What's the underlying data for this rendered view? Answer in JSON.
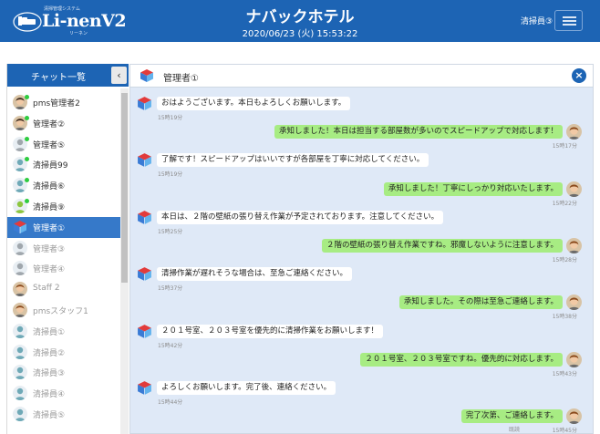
{
  "header": {
    "logo_system": "清掃管理システム",
    "logo_name": "Li-nenV2",
    "logo_ruby": "リーネン",
    "hotel_name": "ナバックホテル",
    "datetime": "2020/06/23 (火) 15:53:22",
    "user": "清掃員③"
  },
  "sidebar": {
    "title": "チャット一覧",
    "collapse_icon": "‹",
    "users": [
      {
        "name": "pms管理者2",
        "status": "online",
        "avatar": "photo-man"
      },
      {
        "name": "管理者②",
        "status": "online",
        "avatar": "photo-man"
      },
      {
        "name": "管理者⑤",
        "status": "online",
        "avatar": "person-grey"
      },
      {
        "name": "清掃員99",
        "status": "online",
        "avatar": "person-teal"
      },
      {
        "name": "清掃員⑥",
        "status": "online",
        "avatar": "person-teal"
      },
      {
        "name": "清掃員⑨",
        "status": "online",
        "avatar": "person-green"
      },
      {
        "name": "管理者①",
        "status": "active",
        "avatar": "cube"
      },
      {
        "name": "管理者③",
        "status": "offline",
        "avatar": "person-grey"
      },
      {
        "name": "管理者④",
        "status": "offline",
        "avatar": "person-grey"
      },
      {
        "name": "Staff 2",
        "status": "offline",
        "avatar": "photo-woman"
      },
      {
        "name": "pmsスタッフ1",
        "status": "offline",
        "avatar": "photo-woman"
      },
      {
        "name": "清掃員①",
        "status": "offline",
        "avatar": "person-teal"
      },
      {
        "name": "清掃員②",
        "status": "offline",
        "avatar": "person-teal"
      },
      {
        "name": "清掃員③",
        "status": "offline",
        "avatar": "person-teal"
      },
      {
        "name": "清掃員④",
        "status": "offline",
        "avatar": "person-teal"
      },
      {
        "name": "清掃員⑤",
        "status": "offline",
        "avatar": "person-teal"
      }
    ]
  },
  "chat": {
    "partner": "管理者①",
    "close_icon": "×",
    "messages": [
      {
        "dir": "in",
        "text": "おはようございます。本日もよろしくお願いします。",
        "time": "15時19分"
      },
      {
        "dir": "out",
        "text": "承知しました！本日は担当する部屋数が多いのでスピードアップで対応します！",
        "time": "15時17分"
      },
      {
        "dir": "in",
        "text": "了解です！スピードアップはいいですが各部屋を丁寧に対応してください。",
        "time": "15時19分"
      },
      {
        "dir": "out",
        "text": "承知しました！丁寧にしっかり対応いたします。",
        "time": "15時22分"
      },
      {
        "dir": "in",
        "text": "本日は、２階の壁紙の張り替え作業が予定されております。注意してください。",
        "time": "15時25分"
      },
      {
        "dir": "out",
        "text": "２階の壁紙の張り替え作業ですね。邪魔しないように注意します。",
        "time": "15時28分"
      },
      {
        "dir": "in",
        "text": "清掃作業が遅れそうな場合は、至急ご連絡ください。",
        "time": "15時37分"
      },
      {
        "dir": "out",
        "text": "承知しました。その際は至急ご連絡します。",
        "time": "15時38分"
      },
      {
        "dir": "in",
        "text": "２０１号室、２０３号室を優先的に清掃作業をお願いします！",
        "time": "15時42分"
      },
      {
        "dir": "out",
        "text": "２０１号室、２０３号室ですね。優先的に対応します。",
        "time": "15時43分"
      },
      {
        "dir": "in",
        "text": "よろしくお願いします。完了後、連絡ください。",
        "time": "15時44分"
      },
      {
        "dir": "out",
        "text": "完了次第、ご連絡します。",
        "time": "15時45分",
        "read": "既読"
      }
    ]
  },
  "colors": {
    "primary": "#1d64b4",
    "active_row": "#3679c9",
    "chat_bg": "#dfe9f7",
    "outgoing_bubble": "#a7ec83",
    "incoming_bubble": "#ffffff",
    "online_dot": "#2ecc40"
  },
  "icons": {
    "menu": "hamburger-icon",
    "logo": "bed-logo-icon",
    "close": "close-circle-icon",
    "partner": "cube-icon"
  }
}
